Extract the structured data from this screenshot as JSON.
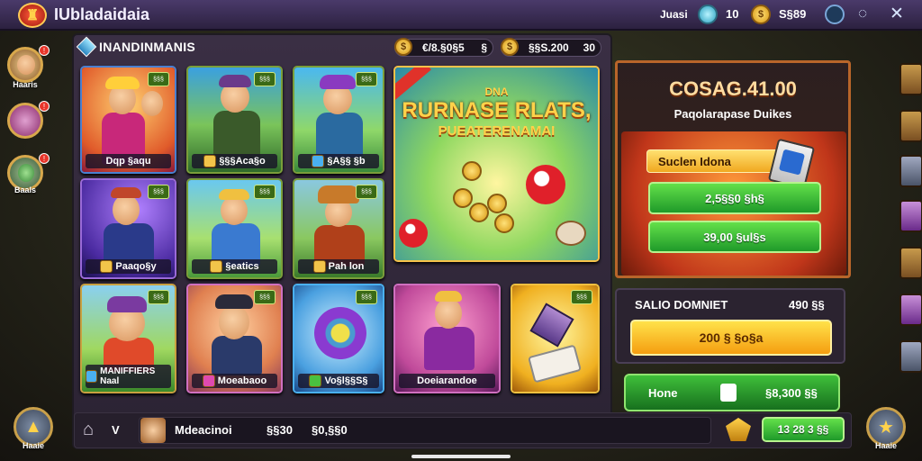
{
  "app": {
    "title": "IUbladaidaia",
    "logo_icon": "castle-icon"
  },
  "topbar": {
    "label": "Juasi",
    "gem_count": "10",
    "gold_value": "S§89",
    "icons": [
      "gem-icon",
      "gold-coin-icon",
      "globe-icon",
      "search-icon",
      "close-icon"
    ]
  },
  "left_rail": {
    "items": [
      {
        "label": "Haaris",
        "badge": "!"
      },
      {
        "label": "",
        "badge": "!"
      },
      {
        "label": "Baals",
        "badge": "!"
      }
    ]
  },
  "panel": {
    "title": "INANDINMANIS",
    "currency1": {
      "value": "€/8.§0§5",
      "suffix": "§"
    },
    "currency2": {
      "value": "§§S.200",
      "suffix": "30"
    }
  },
  "cards": [
    {
      "label": "Dqp §aqu",
      "tag": "§§§"
    },
    {
      "label": "§§§Aca§o",
      "tag": "§§§"
    },
    {
      "label": "§A§§ §b",
      "tag": "§§§"
    },
    {
      "label": "Paaqo§y",
      "tag": "§§§"
    },
    {
      "label": "§eatics",
      "tag": "§§§"
    },
    {
      "label": "Pah lon",
      "tag": "§§§"
    },
    {
      "label": "MANIFFIERS Naal",
      "tag": "§§§"
    },
    {
      "label": "Moeabaoo",
      "tag": "§§§"
    },
    {
      "label": "Vo§l§§S§",
      "tag": "§§§"
    },
    {
      "label": "Doeiarandoe",
      "tag": ""
    },
    {
      "label": "",
      "tag": "§§§"
    }
  ],
  "feature": {
    "line1": "DNA",
    "line2": "RURNASE RLATS,",
    "line3": "PUEATERENAMAI"
  },
  "shop": {
    "heading": "COSAG.41.00",
    "subheading": "Paqolarapase Duikes",
    "select_label": "Suclen Idona",
    "option1": "2,5§§0 §h§",
    "option2": "39,00 §ul§s"
  },
  "sale": {
    "title": "SALIO DOMNIET",
    "amount": "490 §§",
    "button": "200 § §o§a"
  },
  "confirm": {
    "label": "Hone",
    "value": "§8,300 §§"
  },
  "bottombar": {
    "home_icon": "home-icon",
    "v_label": "V",
    "user_name": "Mdeacinoi",
    "price1": "§§30",
    "price2": "§0,§§0",
    "total": "13 28 3 §§"
  },
  "corner": {
    "left_label": "Haaie",
    "right_label": "Haaie"
  }
}
